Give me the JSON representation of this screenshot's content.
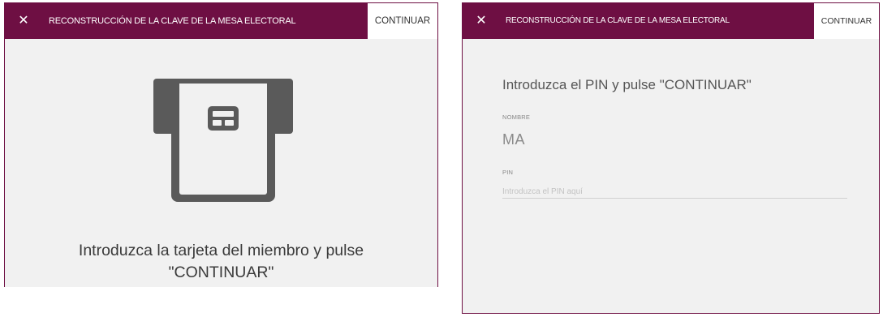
{
  "left_dialog": {
    "close_icon": "close-icon",
    "title": "RECONSTRUCCIÓN DE LA CLAVE DE LA MESA ELECTORAL",
    "continue_label": "CONTINUAR",
    "illustration": "smart-card-insert-icon",
    "instruction_line1": "Introduzca la tarjeta del miembro y pulse",
    "instruction_line2": "\"CONTINUAR\""
  },
  "right_dialog": {
    "close_icon": "close-icon",
    "title": "RECONSTRUCCIÓN DE LA CLAVE DE LA MESA ELECTORAL",
    "continue_label": "CONTINUAR",
    "instruction": "Introduzca el PIN y pulse \"CONTINUAR\"",
    "name_label": "NOMBRE",
    "name_value": "MA",
    "pin_label": "PIN",
    "pin_value": "",
    "pin_placeholder": "Introduzca el PIN aquí"
  },
  "colors": {
    "header": "#6e0f43",
    "panel_bg": "#f1f1f1",
    "icon": "#5a5a5a"
  }
}
